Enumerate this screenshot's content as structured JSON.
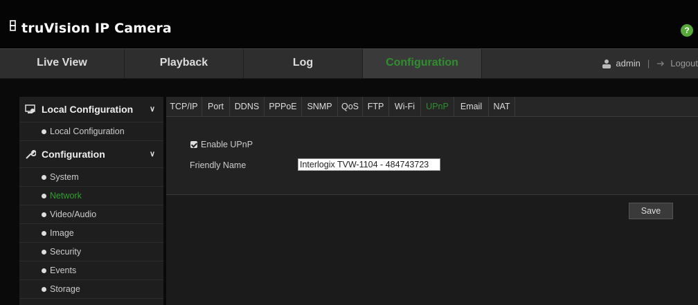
{
  "header": {
    "brand": "truVision IP Camera",
    "help": "?"
  },
  "nav": {
    "items": [
      {
        "label": "Live View"
      },
      {
        "label": "Playback"
      },
      {
        "label": "Log"
      },
      {
        "label": "Configuration",
        "active": true
      }
    ],
    "user": "admin",
    "separator": "|",
    "logout": "Logout"
  },
  "sidebar": {
    "groups": [
      {
        "label": "Local Configuration",
        "items": [
          "Local Configuration"
        ]
      },
      {
        "label": "Configuration",
        "items": [
          "System",
          "Network",
          "Video/Audio",
          "Image",
          "Security",
          "Events",
          "Storage"
        ]
      }
    ],
    "active_item": "Network"
  },
  "tabs": [
    "TCP/IP",
    "Port",
    "DDNS",
    "PPPoE",
    "SNMP",
    "QoS",
    "FTP",
    "Wi-Fi",
    "UPnP",
    "Email",
    "NAT"
  ],
  "active_tab": "UPnP",
  "form": {
    "enable_label": "Enable UPnP",
    "enable_checked": true,
    "friendly_name_label": "Friendly Name",
    "friendly_name_value": "Interlogix TVW-1104 - 484743723"
  },
  "save_label": "Save",
  "colors": {
    "accent": "#2f8f2f",
    "help": "#56a83a"
  }
}
